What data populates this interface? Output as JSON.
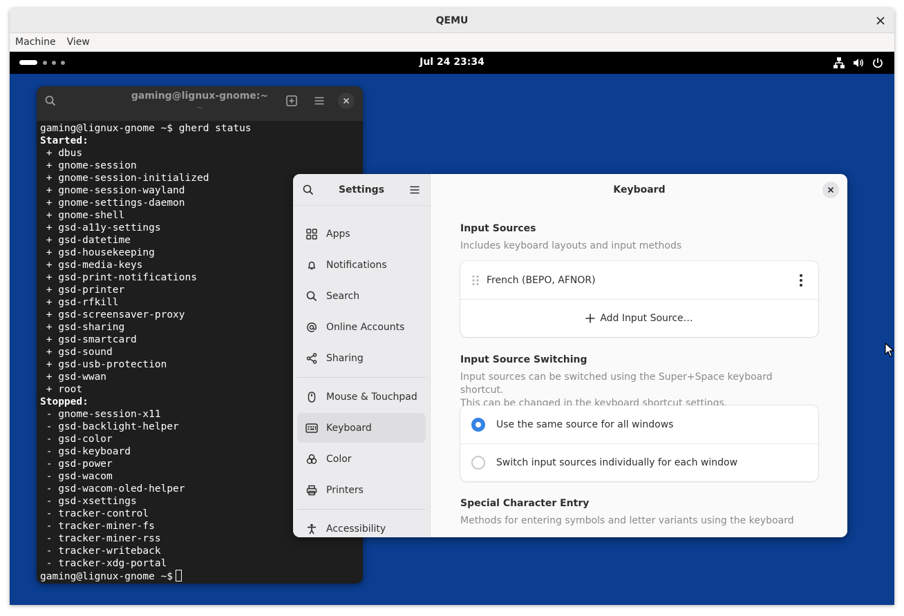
{
  "qemu": {
    "title": "QEMU",
    "menu": [
      "Machine",
      "View"
    ]
  },
  "topbar": {
    "clock": "Jul 24  23:34"
  },
  "terminal": {
    "title": "gaming@lignux-gnome:~",
    "subtitle": "~",
    "lines": [
      {
        "text": "gaming@lignux-gnome ~$ gherd status",
        "bold": false
      },
      {
        "text": "Started:",
        "bold": true
      },
      {
        "text": " + dbus",
        "bold": false
      },
      {
        "text": " + gnome-session",
        "bold": false
      },
      {
        "text": " + gnome-session-initialized",
        "bold": false
      },
      {
        "text": " + gnome-session-wayland",
        "bold": false
      },
      {
        "text": " + gnome-settings-daemon",
        "bold": false
      },
      {
        "text": " + gnome-shell",
        "bold": false
      },
      {
        "text": " + gsd-a11y-settings",
        "bold": false
      },
      {
        "text": " + gsd-datetime",
        "bold": false
      },
      {
        "text": " + gsd-housekeeping",
        "bold": false
      },
      {
        "text": " + gsd-media-keys",
        "bold": false
      },
      {
        "text": " + gsd-print-notifications",
        "bold": false
      },
      {
        "text": " + gsd-printer",
        "bold": false
      },
      {
        "text": " + gsd-rfkill",
        "bold": false
      },
      {
        "text": " + gsd-screensaver-proxy",
        "bold": false
      },
      {
        "text": " + gsd-sharing",
        "bold": false
      },
      {
        "text": " + gsd-smartcard",
        "bold": false
      },
      {
        "text": " + gsd-sound",
        "bold": false
      },
      {
        "text": " + gsd-usb-protection",
        "bold": false
      },
      {
        "text": " + gsd-wwan",
        "bold": false
      },
      {
        "text": " + root",
        "bold": false
      },
      {
        "text": "Stopped:",
        "bold": true
      },
      {
        "text": " - gnome-session-x11",
        "bold": false
      },
      {
        "text": " - gsd-backlight-helper",
        "bold": false
      },
      {
        "text": " - gsd-color",
        "bold": false
      },
      {
        "text": " - gsd-keyboard",
        "bold": false
      },
      {
        "text": " - gsd-power",
        "bold": false
      },
      {
        "text": " - gsd-wacom",
        "bold": false
      },
      {
        "text": " - gsd-wacom-oled-helper",
        "bold": false
      },
      {
        "text": " - gsd-xsettings",
        "bold": false
      },
      {
        "text": " - tracker-control",
        "bold": false
      },
      {
        "text": " - tracker-miner-fs",
        "bold": false
      },
      {
        "text": " - tracker-miner-rss",
        "bold": false
      },
      {
        "text": " - tracker-writeback",
        "bold": false
      },
      {
        "text": " - tracker-xdg-portal",
        "bold": false
      }
    ],
    "prompt": "gaming@lignux-gnome ~$"
  },
  "settings": {
    "sidebar_title": "Settings",
    "items_group1": [
      {
        "label": "Apps",
        "icon": "apps-grid-icon"
      },
      {
        "label": "Notifications",
        "icon": "bell-icon"
      },
      {
        "label": "Search",
        "icon": "search-icon"
      },
      {
        "label": "Online Accounts",
        "icon": "at-sign-icon"
      },
      {
        "label": "Sharing",
        "icon": "share-icon"
      }
    ],
    "items_group2": [
      {
        "label": "Mouse & Touchpad",
        "icon": "mouse-icon"
      },
      {
        "label": "Keyboard",
        "icon": "keyboard-icon"
      },
      {
        "label": "Color",
        "icon": "color-icon"
      },
      {
        "label": "Printers",
        "icon": "printer-icon"
      }
    ],
    "items_group3": [
      {
        "label": "Accessibility",
        "icon": "accessibility-icon"
      }
    ],
    "active_item": "Keyboard",
    "page_title": "Keyboard",
    "input_sources": {
      "title": "Input Sources",
      "description": "Includes keyboard layouts and input methods",
      "source": "French (BEPO, AFNOR)",
      "add_label": "Add Input Source…"
    },
    "switching": {
      "title": "Input Source Switching",
      "description_1": "Input sources can be switched using the Super+Space keyboard shortcut.",
      "description_2": "This can be changed in the keyboard shortcut settings.",
      "option_same": "Use the same source for all windows",
      "option_individual": "Switch input sources individually for each window",
      "selected": "same"
    },
    "special": {
      "title": "Special Character Entry",
      "description": "Methods for entering symbols and letter variants using the keyboard"
    }
  },
  "colors": {
    "desktop": "#0b3d91",
    "accent": "#3584e4",
    "terminal_bg": "#1e1e1e"
  }
}
